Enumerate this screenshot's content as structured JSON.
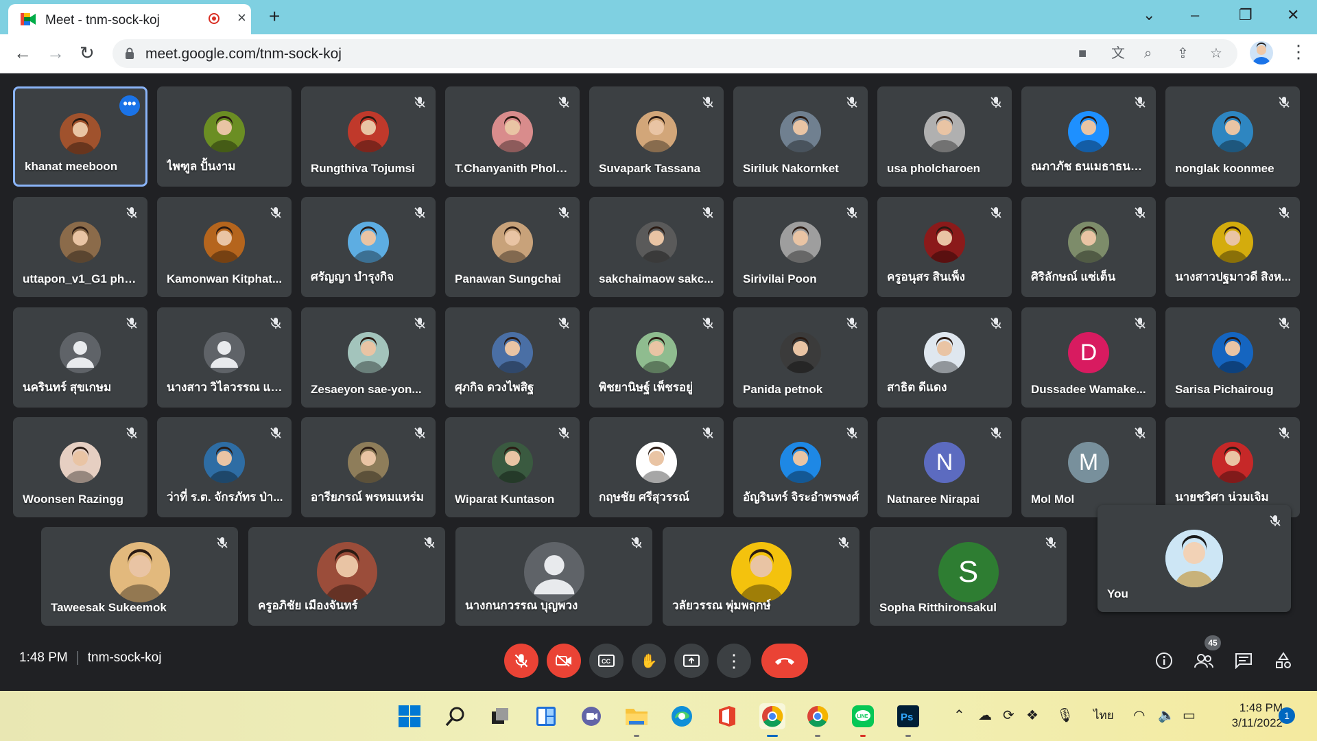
{
  "browser": {
    "tab_title": "Meet - tnm-sock-koj",
    "url": "meet.google.com/tnm-sock-koj",
    "new_tab": "+",
    "close_tab": "×"
  },
  "participants_row1": [
    {
      "name": "khanat meeboon",
      "avatar": "photo",
      "color": "#a0522d",
      "mic": "on",
      "active": true
    },
    {
      "name": "ไพฑูล ปั้นงาม",
      "avatar": "photo",
      "color": "#6b8e23",
      "mic": "on"
    },
    {
      "name": "Rungthiva Tojumsi",
      "avatar": "photo",
      "color": "#c0392b",
      "mic": "off"
    },
    {
      "name": "T.Chanyanith Pholb...",
      "avatar": "photo",
      "color": "#d98c8c",
      "mic": "off"
    },
    {
      "name": "Suvapark Tassana",
      "avatar": "photo",
      "color": "#d2a679",
      "mic": "off"
    },
    {
      "name": "Siriluk Nakornket",
      "avatar": "photo",
      "color": "#708090",
      "mic": "off"
    },
    {
      "name": "usa pholcharoen",
      "avatar": "photo",
      "color": "#b0b0b0",
      "mic": "off"
    },
    {
      "name": "ณภาภัช ธนเมธาธนาธิป",
      "avatar": "photo",
      "color": "#1e90ff",
      "mic": "off"
    },
    {
      "name": "nonglak koonmee",
      "avatar": "photo",
      "color": "#2e86c1",
      "mic": "off"
    }
  ],
  "participants_row2": [
    {
      "name": "uttapon_v1_G1 phol...",
      "avatar": "photo",
      "color": "#8b6b4a",
      "mic": "off"
    },
    {
      "name": "Kamonwan Kitphat...",
      "avatar": "photo",
      "color": "#b5651d",
      "mic": "off"
    },
    {
      "name": "ศรัญญา บำรุงกิจ",
      "avatar": "photo",
      "color": "#5dade2",
      "mic": "off"
    },
    {
      "name": "Panawan Sungchai",
      "avatar": "photo",
      "color": "#c8a27a",
      "mic": "off"
    },
    {
      "name": "sakchaimaow sakc...",
      "avatar": "photo",
      "color": "#5a5a5a",
      "mic": "off"
    },
    {
      "name": "Sirivilai Poon",
      "avatar": "photo",
      "color": "#9e9e9e",
      "mic": "off"
    },
    {
      "name": "ครูอนุสร สินเพ็ง",
      "avatar": "photo",
      "color": "#8b1a1a",
      "mic": "off"
    },
    {
      "name": "ศิริลักษณ์ แซ่เต็น",
      "avatar": "photo",
      "color": "#7d8c6a",
      "mic": "off"
    },
    {
      "name": "นางสาวปฐมาวดี สิงห...",
      "avatar": "photo",
      "color": "#d4ac0d",
      "mic": "off"
    }
  ],
  "participants_row3": [
    {
      "name": "นครินทร์ สุขเกษม",
      "avatar": "default",
      "color": "#5f6368",
      "mic": "off"
    },
    {
      "name": "นางสาว วิไลวรรณ แซ่...",
      "avatar": "default",
      "color": "#5f6368",
      "mic": "off"
    },
    {
      "name": "Zesaeyon sae-yon...",
      "avatar": "photo",
      "color": "#a3c4bc",
      "mic": "off"
    },
    {
      "name": "ศุภกิจ ดวงไพสิฐ",
      "avatar": "photo",
      "color": "#4a6fa5",
      "mic": "off"
    },
    {
      "name": "พิชยานิษฐ์ เพ็ชรอยู่",
      "avatar": "photo",
      "color": "#8fbc8f",
      "mic": "off"
    },
    {
      "name": "Panida petnok",
      "avatar": "photo",
      "color": "#3b3b3b",
      "mic": "off"
    },
    {
      "name": "สาธิต ดีแดง",
      "avatar": "photo",
      "color": "#dfe7ef",
      "mic": "off"
    },
    {
      "name": "Dussadee Wamake...",
      "avatar": "letter",
      "letter": "D",
      "color": "#d81b60",
      "mic": "off"
    },
    {
      "name": "Sarisa Pichairoug",
      "avatar": "photo",
      "color": "#1565c0",
      "mic": "off"
    }
  ],
  "participants_row4": [
    {
      "name": "Woonsen Razingg",
      "avatar": "photo",
      "color": "#e6cfc2",
      "mic": "off"
    },
    {
      "name": "ว่าที่ ร.ต. จักรภัทร ป่า...",
      "avatar": "photo",
      "color": "#2e6da4",
      "mic": "off"
    },
    {
      "name": "อารียภรณ์ พรหมแหร่ม",
      "avatar": "photo",
      "color": "#8e7d5a",
      "mic": "off"
    },
    {
      "name": "Wiparat Kuntason",
      "avatar": "photo",
      "color": "#3a5a40",
      "mic": "off"
    },
    {
      "name": "กฤษชัย ศรีสุวรรณ์",
      "avatar": "photo",
      "color": "#ffffff",
      "mic": "off"
    },
    {
      "name": "อัญรินทร์ จิระอำพรพงศ์",
      "avatar": "photo",
      "color": "#1e88e5",
      "mic": "off"
    },
    {
      "name": "Natnaree Nirapai",
      "avatar": "letter",
      "letter": "N",
      "color": "#5c6bc0",
      "mic": "off"
    },
    {
      "name": "Mol Mol",
      "avatar": "letter",
      "letter": "M",
      "color": "#78909c",
      "mic": "off"
    },
    {
      "name": "นายชวิศา น่วมเจิม",
      "avatar": "photo",
      "color": "#c62828",
      "mic": "off"
    }
  ],
  "participants_row5": [
    {
      "name": "Taweesak Sukeemok",
      "avatar": "photo",
      "color": "#e2b97d",
      "mic": "off"
    },
    {
      "name": "ครูอภิชัย เมืองจันทร์",
      "avatar": "photo",
      "color": "#9b4d3a",
      "mic": "off"
    },
    {
      "name": "นางกนกวรรณ บุญพวง",
      "avatar": "default",
      "color": "#5f6368",
      "mic": "off"
    },
    {
      "name": "วลัยวรรณ พุ่มพฤกษ์",
      "avatar": "photo",
      "color": "#f4c20d",
      "mic": "off"
    },
    {
      "name": "Sopha Ritthironsakul",
      "avatar": "letter",
      "letter": "S",
      "color": "#2e7d32",
      "mic": "off"
    }
  ],
  "self_view": {
    "name": "You",
    "mic": "off"
  },
  "call_bar": {
    "time": "1:48 PM",
    "meeting_code": "tnm-sock-koj",
    "participant_count": "45"
  },
  "taskbar": {
    "language": "ไทย",
    "time": "1:48 PM",
    "date": "3/11/2022",
    "notifications": "1"
  }
}
